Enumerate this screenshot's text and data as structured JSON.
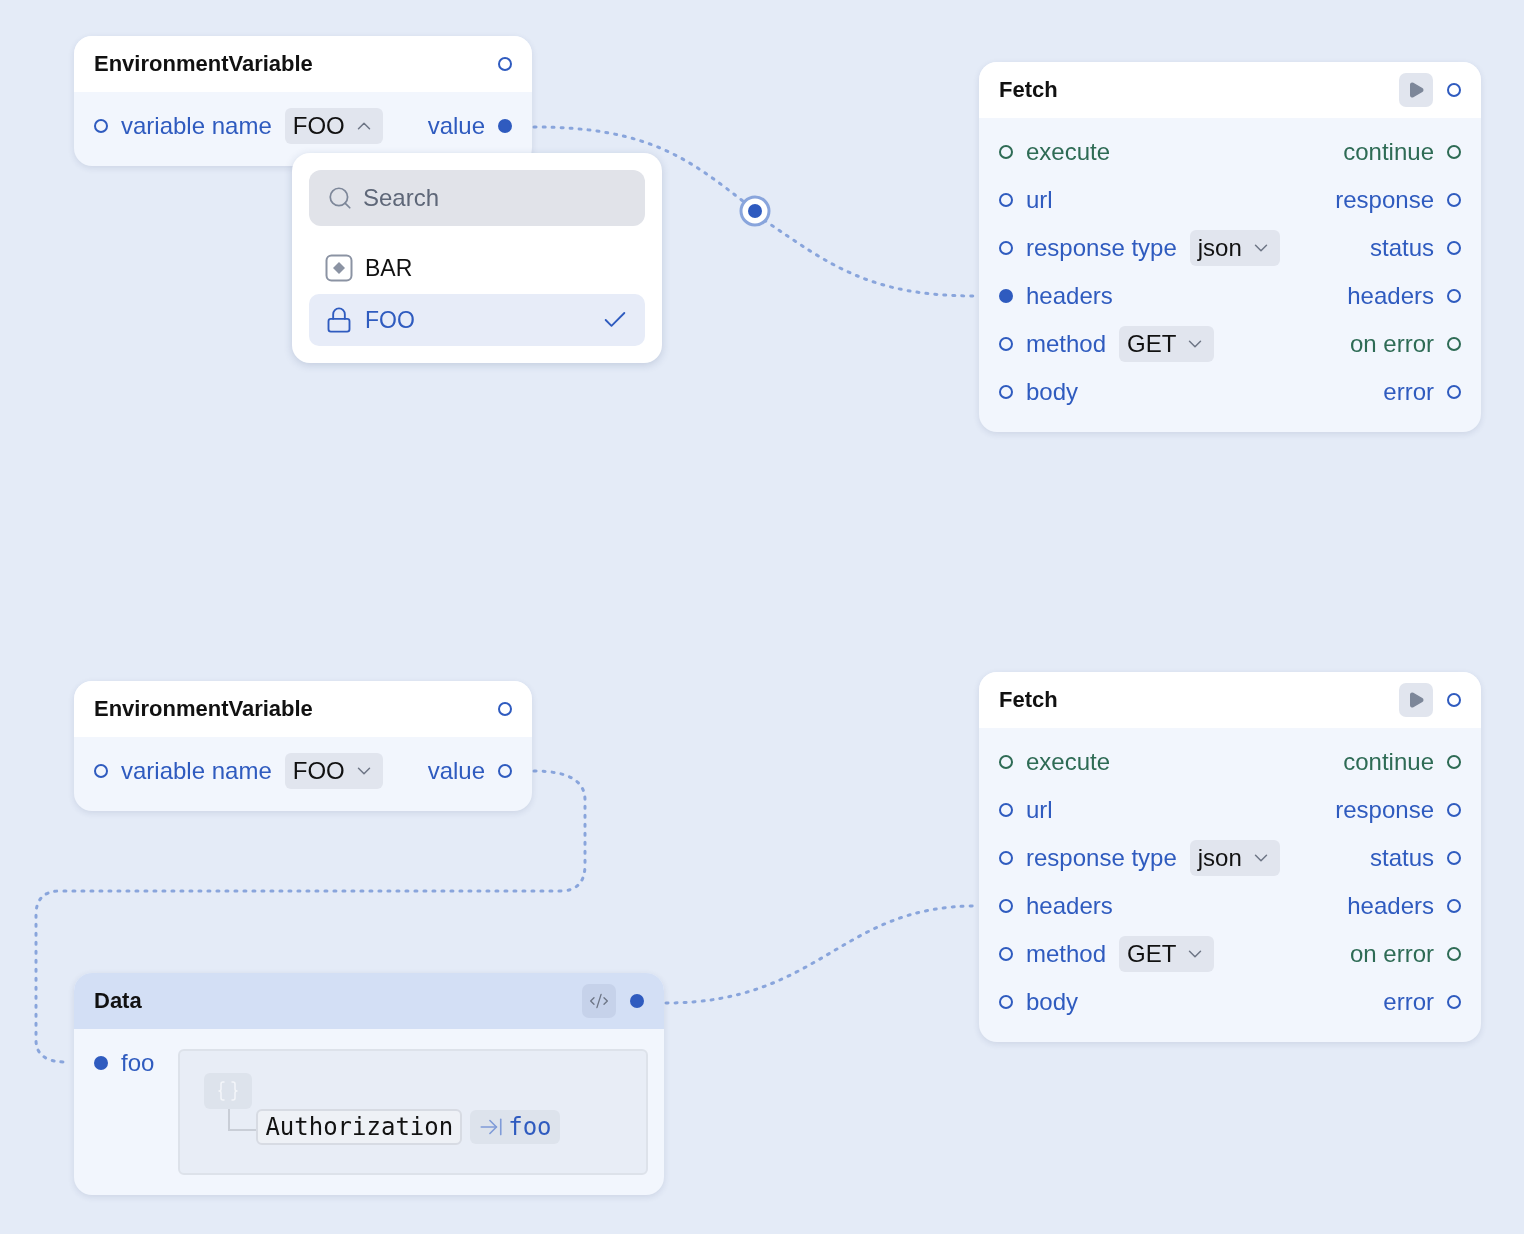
{
  "nodes": [
    {
      "kind": "env",
      "title": "EnvironmentVariable",
      "output_connected": false,
      "input": {
        "label": "variable name",
        "connected": false,
        "select": {
          "value": "FOO",
          "open": true
        }
      },
      "output": {
        "label": "value",
        "connected": true
      },
      "dropdown": {
        "search_placeholder": "Search",
        "options": [
          {
            "label": "BAR",
            "kind": "plain",
            "selected": false
          },
          {
            "label": "FOO",
            "kind": "secret",
            "selected": true
          }
        ]
      }
    },
    {
      "kind": "fetch",
      "title": "Fetch",
      "output_connected": false,
      "rows": [
        {
          "input": {
            "label": "execute",
            "kind": "exec",
            "connected": false
          },
          "output": {
            "label": "continue",
            "kind": "exec",
            "connected": false
          }
        },
        {
          "input": {
            "label": "url",
            "kind": "data",
            "connected": false
          },
          "output": {
            "label": "response",
            "kind": "data",
            "connected": false
          }
        },
        {
          "input": {
            "label": "response type",
            "kind": "data",
            "connected": false,
            "select": {
              "value": "json",
              "open": false
            }
          },
          "output": {
            "label": "status",
            "kind": "data",
            "connected": false
          }
        },
        {
          "input": {
            "label": "headers",
            "kind": "data",
            "connected": true
          },
          "output": {
            "label": "headers",
            "kind": "data",
            "connected": false
          }
        },
        {
          "input": {
            "label": "method",
            "kind": "data",
            "connected": false,
            "select": {
              "value": "GET",
              "open": false
            }
          },
          "output": {
            "label": "on error",
            "kind": "exec",
            "connected": false
          }
        },
        {
          "input": {
            "label": "body",
            "kind": "data",
            "connected": false
          },
          "output": {
            "label": "error",
            "kind": "data",
            "connected": false
          }
        }
      ]
    },
    {
      "kind": "env",
      "title": "EnvironmentVariable",
      "output_connected": false,
      "input": {
        "label": "variable name",
        "connected": false,
        "select": {
          "value": "FOO",
          "open": false
        }
      },
      "output": {
        "label": "value",
        "connected": false
      }
    },
    {
      "kind": "fetch",
      "title": "Fetch",
      "output_connected": false,
      "rows": [
        {
          "input": {
            "label": "execute",
            "kind": "exec",
            "connected": false
          },
          "output": {
            "label": "continue",
            "kind": "exec",
            "connected": false
          }
        },
        {
          "input": {
            "label": "url",
            "kind": "data",
            "connected": false
          },
          "output": {
            "label": "response",
            "kind": "data",
            "connected": false
          }
        },
        {
          "input": {
            "label": "response type",
            "kind": "data",
            "connected": false,
            "select": {
              "value": "json",
              "open": false
            }
          },
          "output": {
            "label": "status",
            "kind": "data",
            "connected": false
          }
        },
        {
          "input": {
            "label": "headers",
            "kind": "data",
            "connected": false
          },
          "output": {
            "label": "headers",
            "kind": "data",
            "connected": false
          }
        },
        {
          "input": {
            "label": "method",
            "kind": "data",
            "connected": false,
            "select": {
              "value": "GET",
              "open": false
            }
          },
          "output": {
            "label": "on error",
            "kind": "exec",
            "connected": false
          }
        },
        {
          "input": {
            "label": "body",
            "kind": "data",
            "connected": false
          },
          "output": {
            "label": "error",
            "kind": "data",
            "connected": false
          }
        }
      ]
    },
    {
      "kind": "data",
      "title": "Data",
      "output_connected": true,
      "input": {
        "label": "foo",
        "connected": true
      },
      "fields": [
        {
          "key": "Authorization",
          "ref": "foo"
        }
      ]
    }
  ]
}
